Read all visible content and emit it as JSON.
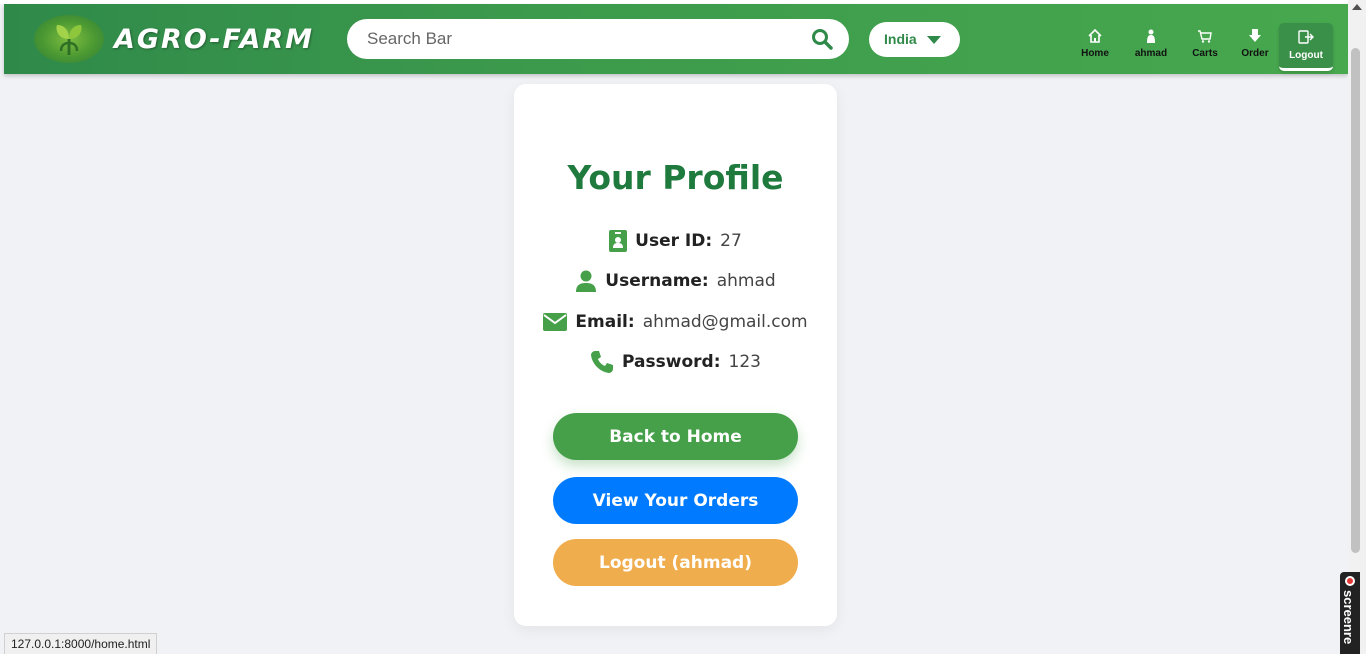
{
  "navbar": {
    "brand": "AGRO-FARM",
    "search_placeholder": "Search Bar",
    "country": "India",
    "items": [
      {
        "label": "Home",
        "icon": "home-icon"
      },
      {
        "label": "ahmad",
        "icon": "user-icon"
      },
      {
        "label": "Carts",
        "icon": "cart-icon"
      },
      {
        "label": "Order",
        "icon": "order-icon"
      },
      {
        "label": "Logout",
        "icon": "logout-icon"
      }
    ]
  },
  "profile": {
    "title": "Your Profile",
    "fields": [
      {
        "label": "User ID:",
        "value": "27",
        "icon": "id-card-icon"
      },
      {
        "label": "Username:",
        "value": "ahmad",
        "icon": "user-icon"
      },
      {
        "label": "Email:",
        "value": "ahmad@gmail.com",
        "icon": "envelope-icon"
      },
      {
        "label": "Password:",
        "value": "123",
        "icon": "phone-icon"
      }
    ],
    "buttons": {
      "home": "Back to Home",
      "orders": "View Your Orders",
      "logout": "Logout (ahmad)"
    }
  },
  "status_url": "127.0.0.1:8000/home.html",
  "recorder_label": "screenre",
  "colors": {
    "brand_green": "#2f8a4a",
    "title_green": "#1e7a3d",
    "home_button": "#45a049",
    "orders_button": "#007bff",
    "logout_button": "#f0ad4e"
  }
}
